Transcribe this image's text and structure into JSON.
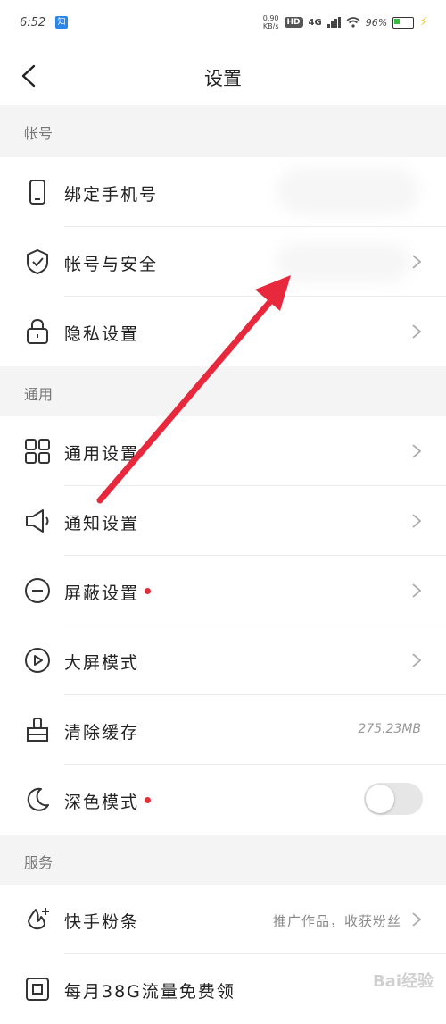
{
  "status_bar": {
    "time": "6:52",
    "speed_value": "0.90",
    "speed_unit": "KB/s",
    "hd_badge": "HD",
    "network": "4G",
    "battery_percent": "96%",
    "app_badge": "知乎"
  },
  "nav": {
    "title": "设置"
  },
  "sections": {
    "account": "帐号",
    "general": "通用",
    "service": "服务"
  },
  "rows": {
    "bind_phone": "绑定手机号",
    "account_security": "帐号与安全",
    "privacy": "隐私设置",
    "general_settings": "通用设置",
    "notification": "通知设置",
    "block": "屏蔽设置",
    "big_screen": "大屏模式",
    "clear_cache": "清除缓存",
    "cache_size": "275.23MB",
    "dark_mode": "深色模式",
    "fans": "快手粉条",
    "fans_value": "推广作品，收获粉丝",
    "monthly_data": "每月38G流量免费领"
  },
  "toggles": {
    "dark_mode_on": false
  },
  "colors": {
    "accent_dot": "#e0303a",
    "arrow": "#e8283c",
    "section_bg": "#f4f4f4"
  },
  "watermark": "Bai经验"
}
